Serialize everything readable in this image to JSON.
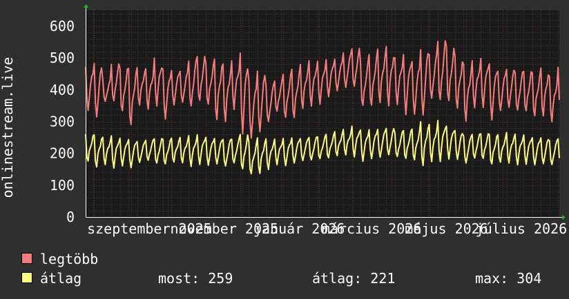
{
  "chart_data": {
    "type": "line",
    "ylabel": "onlinestream.live",
    "ylim": [
      0,
      650
    ],
    "yticks": [
      0,
      100,
      200,
      300,
      400,
      500,
      600
    ],
    "xticks": [
      "szeptember 2025",
      "november 2025",
      "január 2026",
      "március 2026",
      "május 2026",
      "július 2026"
    ],
    "x_start": "2025-07-26",
    "x_end": "2026-08-16",
    "grid": true,
    "series": [
      {
        "name": "legtöbb",
        "color": "#f87c7c",
        "weekly_min": [
          330,
          300,
          355,
          350,
          320,
          280,
          350,
          340,
          350,
          305,
          345,
          350,
          330,
          350,
          345,
          300,
          300,
          340,
          260,
          240,
          250,
          285,
          320,
          300,
          305,
          340,
          350,
          355,
          375,
          390,
          395,
          395,
          335,
          340,
          355,
          350,
          355,
          320,
          315,
          300,
          355,
          345,
          350,
          335,
          300,
          345,
          345,
          300,
          325,
          330,
          320,
          320,
          310,
          315,
          300,
          330,
          330
        ],
        "weekly_max": [
          480,
          500,
          440,
          495,
          480,
          475,
          470,
          465,
          500,
          470,
          470,
          470,
          510,
          520,
          490,
          500,
          480,
          490,
          520,
          440,
          480,
          430,
          440,
          460,
          470,
          480,
          490,
          490,
          500,
          505,
          530,
          545,
          500,
          520,
          530,
          535,
          500,
          515,
          500,
          550,
          530,
          575,
          550,
          510,
          480,
          490,
          500,
          490,
          470,
          480,
          470,
          470,
          460,
          470,
          440,
          470,
          470
        ]
      },
      {
        "name": "átlag",
        "color": "#fcfc7c",
        "weekly_min": [
          170,
          155,
          165,
          155,
          160,
          150,
          165,
          170,
          160,
          160,
          170,
          170,
          160,
          165,
          160,
          160,
          150,
          160,
          140,
          130,
          135,
          150,
          165,
          160,
          165,
          170,
          170,
          175,
          180,
          190,
          195,
          190,
          175,
          180,
          180,
          185,
          180,
          175,
          175,
          160,
          175,
          175,
          180,
          175,
          160,
          175,
          175,
          160,
          170,
          170,
          165,
          165,
          160,
          160,
          155,
          165,
          165
        ],
        "weekly_max": [
          265,
          260,
          250,
          255,
          250,
          250,
          245,
          250,
          255,
          250,
          250,
          250,
          255,
          260,
          255,
          255,
          255,
          255,
          270,
          240,
          250,
          245,
          245,
          250,
          255,
          255,
          260,
          260,
          265,
          270,
          275,
          285,
          275,
          280,
          285,
          290,
          275,
          280,
          280,
          300,
          290,
          304,
          290,
          280,
          265,
          270,
          270,
          265,
          260,
          265,
          260,
          260,
          255,
          258,
          250,
          255,
          259
        ]
      }
    ],
    "stats": {
      "most_label": "most:",
      "most_value": "259",
      "atlag_label": "átlag:",
      "atlag_value": "221",
      "max_label": "max:",
      "max_value": "304"
    }
  },
  "legend": {
    "items": [
      {
        "label": "legtöbb",
        "color": "#f87c7c"
      },
      {
        "label": "átlag",
        "color": "#fcfc7c"
      }
    ]
  }
}
